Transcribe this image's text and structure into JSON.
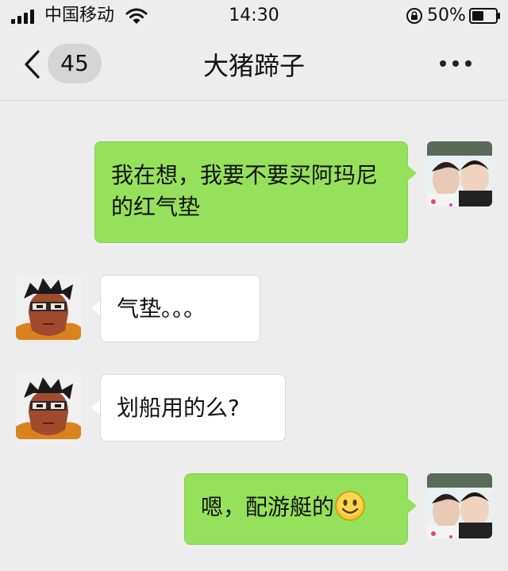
{
  "status_bar": {
    "carrier": "中国移动",
    "time": "14:30",
    "battery_percent": "50%",
    "battery_level": 0.5,
    "signal_bars": 4,
    "icons": [
      "signal-bars-icon",
      "wifi-icon",
      "rotation-lock-icon",
      "battery-icon"
    ]
  },
  "nav": {
    "back_icon": "chevron-left-icon",
    "unread_count": "45",
    "title": "大猪蹄子",
    "more_icon": "ellipsis-icon"
  },
  "messages": [
    {
      "sender": "me",
      "text": "我在想，我要不要买阿玛尼的红气垫",
      "avatar": "self-avatar-photo"
    },
    {
      "sender": "them",
      "text": "气垫。。。",
      "avatar": "contact-avatar-cartoon"
    },
    {
      "sender": "them",
      "text": "划船用的么?",
      "avatar": "contact-avatar-cartoon"
    },
    {
      "sender": "me",
      "text": "嗯，配游艇的",
      "emoji": "smiley-emoji",
      "avatar": "self-avatar-photo"
    }
  ],
  "colors": {
    "background": "#ededed",
    "my_bubble": "#95e15b",
    "their_bubble": "#ffffff"
  }
}
